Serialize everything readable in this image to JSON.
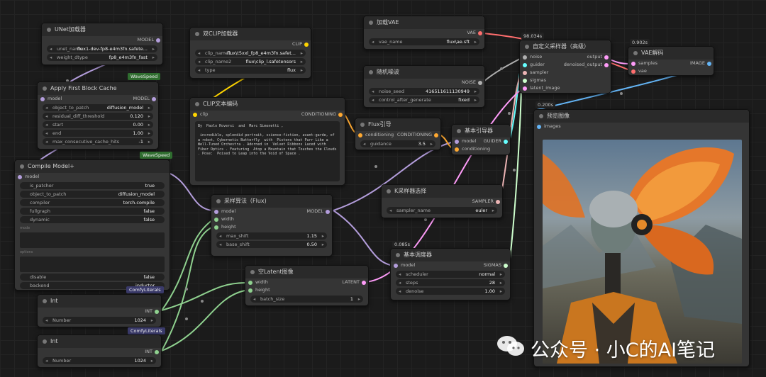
{
  "colors": {
    "model": "#b39ddb",
    "clip": "#ffd500",
    "vae": "#ff6e6e",
    "conditioning": "#ffa931",
    "latent": "#ff9cf9",
    "int": "#8fd18f",
    "noise": "#b0b0b0",
    "guider": "#66ffff",
    "sampler": "#ecb4b4",
    "sigmas": "#cdffcd",
    "image": "#64b5f6"
  },
  "unet": {
    "title": "UNet加载器",
    "out": "MODEL",
    "w": [
      {
        "k": "unet_name",
        "v": "flux1-dev-fp8-e4m3fn.safete..."
      },
      {
        "k": "weight_dtype",
        "v": "fp8_e4m3fn_fast"
      }
    ]
  },
  "wavespeed1": "WaveSpeed",
  "fbc": {
    "title": "Apply First Block Cache",
    "in": "model",
    "out": "MODEL",
    "w": [
      {
        "k": "object_to_patch",
        "v": "diffusion_model"
      },
      {
        "k": "residual_diff_threshold",
        "v": "0.120"
      },
      {
        "k": "start",
        "v": "0.00"
      },
      {
        "k": "end",
        "v": "1.00"
      },
      {
        "k": "max_consecutive_cache_hits",
        "v": "-1"
      }
    ]
  },
  "wavespeed2": "WaveSpeed",
  "compile": {
    "title": "Compile Model+",
    "in": "model",
    "w": [
      {
        "k": "is_patcher",
        "v": "true"
      },
      {
        "k": "object_to_patch",
        "v": "diffusion_model"
      },
      {
        "k": "compiler",
        "v": "torch.compile"
      },
      {
        "k": "fullgraph",
        "v": "false"
      },
      {
        "k": "dynamic",
        "v": "false"
      }
    ],
    "mode": "mode",
    "options": "options",
    "w2": [
      {
        "k": "disable",
        "v": "false"
      },
      {
        "k": "backend",
        "v": "inductor"
      }
    ]
  },
  "comfy1": "ComfyLiterals",
  "comfy2": "ComfyLiterals",
  "int1": {
    "title": "Int",
    "out": "INT",
    "k": "Number",
    "v": "1024"
  },
  "int2": {
    "title": "Int",
    "out": "INT",
    "k": "Number",
    "v": "1024"
  },
  "dclip": {
    "title": "双CLIP加载器",
    "out": "CLIP",
    "w": [
      {
        "k": "clip_name1",
        "v": "flux\\t5xxl_fp8_e4m3fn.safet..."
      },
      {
        "k": "clip_name2",
        "v": "flux\\clip_l.safetensors"
      },
      {
        "k": "type",
        "v": "flux"
      }
    ]
  },
  "cte": {
    "title": "CLIP文本编码",
    "in": "clip",
    "out": "CONDITIONING",
    "text": "By  Paolo Roversi  and  Marc Simonetti ,\n\n incredible, splendid portrait, science-fiction, avant-garde, of a robot, Cybernetic Butterfly  with  Pistons that Purr Like a Well-Tuned Orchestra . Adorned in  Velvet Ribbons Laced with Fiber Optics . Featuring  Atop a Mountain that Touches the Clouds . Pose:  Poised to Leap into the Void of Space ."
  },
  "vae": {
    "title": "加载VAE",
    "out": "VAE",
    "k": "vae_name",
    "v": "flux\\ae.sft"
  },
  "noise": {
    "title": "随机噪波",
    "out": "NOISE",
    "w": [
      {
        "k": "noise_seed",
        "v": "416511611130949"
      },
      {
        "k": "control_after_generate",
        "v": "fixed"
      }
    ]
  },
  "flux": {
    "title": "Flux引导",
    "in": "conditioning",
    "out": "CONDITIONING",
    "k": "guidance",
    "v": "3.5"
  },
  "guide": {
    "title": "基本引导器",
    "in1": "model",
    "in2": "conditioning",
    "out": "GUIDER"
  },
  "csampler": {
    "title": "自定义采样器（高级）",
    "timer": "98.034s",
    "ins": [
      "noise",
      "guider",
      "sampler",
      "sigmas",
      "latent_image"
    ],
    "outs": [
      "output",
      "denoised_output"
    ]
  },
  "vaed": {
    "title": "VAE解码",
    "timer": "0.902s",
    "ins": [
      "samples",
      "vae"
    ],
    "out": "IMAGE"
  },
  "preview": {
    "title": "预览图像",
    "timer": "0.200s",
    "in": "images"
  },
  "ksel": {
    "title": "K采样器选择",
    "out": "SAMPLER",
    "k": "sampler_name",
    "v": "euler"
  },
  "msf": {
    "title": "采样算法（Flux)",
    "in": [
      "model",
      "width",
      "height"
    ],
    "out": "MODEL",
    "w": [
      {
        "k": "max_shift",
        "v": "1.15"
      },
      {
        "k": "base_shift",
        "v": "0.50"
      }
    ]
  },
  "latent": {
    "title": "空Latent图像",
    "in": [
      "width",
      "height"
    ],
    "out": "LATENT",
    "k": "batch_size",
    "v": "1"
  },
  "sched": {
    "title": "基本调度器",
    "timer": "0.085s",
    "in": "model",
    "out": "SIGMAS",
    "w": [
      {
        "k": "scheduler",
        "v": "normal"
      },
      {
        "k": "steps",
        "v": "28"
      },
      {
        "k": "denoise",
        "v": "1.00"
      }
    ]
  },
  "watermark": "公众号 · 小C的AI笔记"
}
